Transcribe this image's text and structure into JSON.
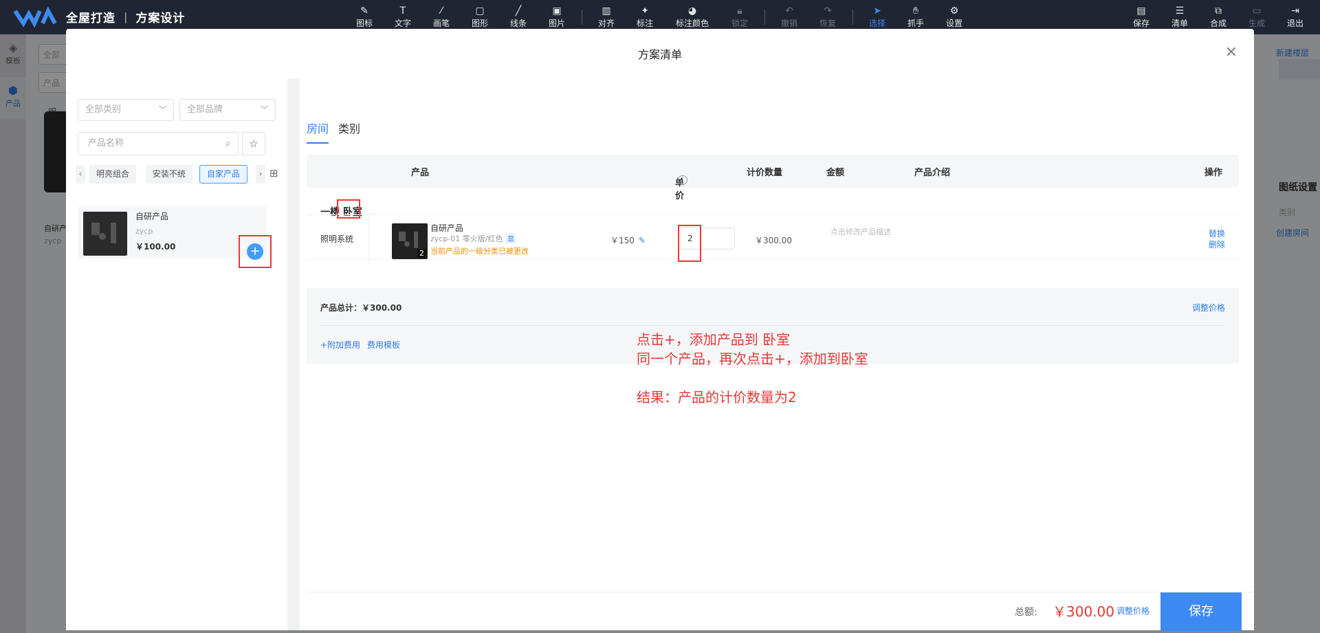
{
  "app": {
    "title": "全屋打造",
    "subtitle": "方案设计"
  },
  "toolbar": {
    "tools": [
      {
        "label": "图标",
        "icon": "pen-nib-icon"
      },
      {
        "label": "文字",
        "icon": "text-icon"
      },
      {
        "label": "画笔",
        "icon": "brush-icon"
      },
      {
        "label": "图形",
        "icon": "shape-icon"
      },
      {
        "label": "线条",
        "icon": "line-icon"
      },
      {
        "label": "图片",
        "icon": "image-icon"
      },
      {
        "label": "对齐",
        "icon": "align-icon"
      },
      {
        "label": "标注",
        "icon": "pin-icon"
      },
      {
        "label": "标注颜色",
        "icon": "palette-icon"
      },
      {
        "label": "锁定",
        "icon": "lock-icon"
      },
      {
        "label": "撤销",
        "icon": "undo-icon"
      },
      {
        "label": "恢复",
        "icon": "redo-icon"
      },
      {
        "label": "选择",
        "icon": "cursor-icon"
      },
      {
        "label": "抓手",
        "icon": "hand-icon"
      },
      {
        "label": "设置",
        "icon": "gear-icon"
      }
    ],
    "right": [
      {
        "label": "保存",
        "icon": "save-icon"
      },
      {
        "label": "清单",
        "icon": "list-icon"
      },
      {
        "label": "合成",
        "icon": "compose-icon"
      },
      {
        "label": "生成",
        "icon": "generate-icon"
      },
      {
        "label": "退出",
        "icon": "exit-icon"
      }
    ]
  },
  "leftnav": [
    {
      "label": "模板",
      "icon": "layers-icon"
    },
    {
      "label": "产品",
      "icon": "cube-icon"
    }
  ],
  "background": {
    "new_floor": "新建楼层",
    "drawing_settings": "图纸设置",
    "category": "类别",
    "create_room": "创建房间",
    "all": "全部",
    "product": "产品",
    "bright": "明",
    "self_product": "自研产",
    "zycp": "zycp"
  },
  "modal": {
    "title": "方案清单",
    "left": {
      "category_select": "全部类别",
      "brand_select": "全部品牌",
      "search_placeholder": "产品名称",
      "tags": [
        "明亮组合",
        "安装不统",
        "自家产品"
      ],
      "product": {
        "name": "自研产品",
        "brand": "zycp",
        "price": "￥100.00"
      }
    },
    "tabs": [
      "房间",
      "类别"
    ],
    "table": {
      "headers": {
        "product": "产品",
        "unit_price": "单价",
        "qty": "计价数量",
        "amount": "金额",
        "desc": "产品介绍",
        "ops": "操作"
      },
      "room_floor": "一楼",
      "room_name": "卧室",
      "row": {
        "category": "照明系统",
        "thumb_qty": "2",
        "name": "自研产品",
        "spec": "zycp-01 零火版/红色",
        "spec_tag": "显",
        "warning": "当前产品的一级分类已被更改",
        "unit_price": "￥150",
        "qty": "2",
        "amount": "￥300.00",
        "desc_placeholder": "点击修改产品描述",
        "replace": "替换",
        "delete": "删除"
      }
    },
    "summary": {
      "total": "产品总计：￥300.00",
      "adjust": "调整价格",
      "add_fee": "+附加费用",
      "fee_template": "费用模板"
    },
    "annotation": {
      "line1": "点击+，添加产品到 卧室",
      "line2": "同一个产品，再次点击+，添加到卧室",
      "line3": "结果：产品的计价数量为2"
    },
    "footer": {
      "total_label": "总额:",
      "total_value": "￥300.00",
      "adjust": "调整价格",
      "save": "保存"
    }
  }
}
